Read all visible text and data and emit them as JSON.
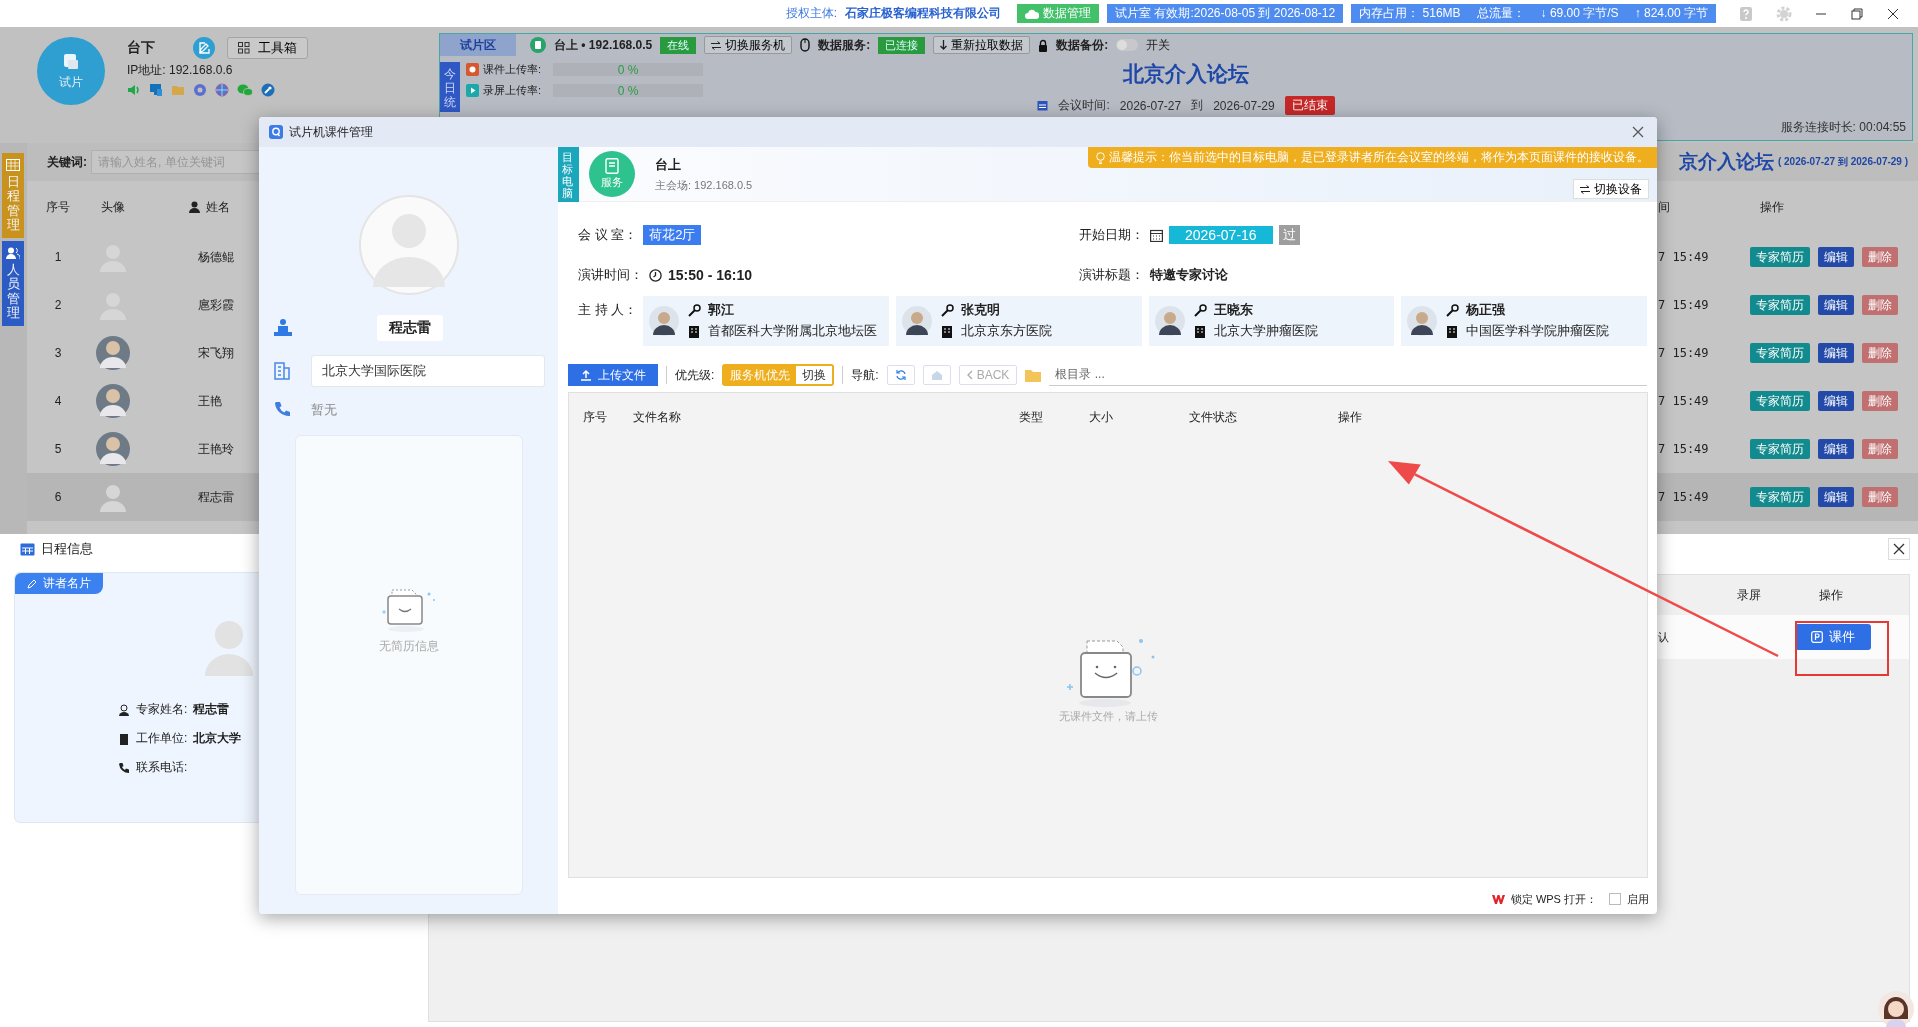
{
  "title_bar": {
    "license_label": "授权主体:",
    "license_holder": "石家庄极客编程科技有限公司",
    "data_button": "数据管理",
    "validity": "试片室 有效期:2026-08-05 到 2026-08-12",
    "memory": "内存占用： 516MB",
    "traffic_label": "总流量：",
    "download": "↓ 69.00 字节/S",
    "upload": "↑ 824.00 字节"
  },
  "station": {
    "avatar_label": "试片",
    "name": "台下",
    "toolbox_button": "工具箱",
    "ip": "IP地址: 192.168.0.6"
  },
  "status_panel": {
    "zone_tab": "试片区",
    "server": "台上 • 192.168.0.5",
    "server_status": "在线",
    "switch_button": "切换服务机",
    "data_service_label": "数据服务:",
    "data_service_status": "已连接",
    "refetch_button": "重新拉取数据",
    "backup_label": "数据备份:",
    "backup_switch": {
      "on": false,
      "label": "开关"
    },
    "stats_tab": "今日统",
    "rates": [
      {
        "label": "课件上传率:",
        "level": 0,
        "reading": "0 %"
      },
      {
        "label": "录屏上传率:",
        "level": 0,
        "reading": "0 %"
      }
    ],
    "meeting_title": "北京介入论坛",
    "meeting_time_label": "会议时间:",
    "meeting_start": "2026-07-27",
    "meeting_to": "到",
    "meeting_end": "2026-07-29",
    "meeting_status": "已结束",
    "uptime": "服务连接时长: 00:04:55"
  },
  "sidebar": [
    {
      "label": "日程管理",
      "color": "#c8921c"
    },
    {
      "label": "人员管理",
      "color": "#2c5bc4"
    }
  ],
  "people": {
    "search": {
      "label": "关键词:",
      "placeholder": "请输入姓名, 单位关键词"
    },
    "forum_title": "京介入论坛",
    "forum_dates": "( 2026-07-27 到 2026-07-29 )",
    "columns": [
      "序号",
      "头像",
      "姓名",
      "间",
      "操作"
    ],
    "rows": [
      {
        "index": "1",
        "name": "杨德鲲",
        "photo": false,
        "time": "7 15:49",
        "actions": [
          "专家简历",
          "编辑",
          "删除"
        ],
        "selected": false
      },
      {
        "index": "2",
        "name": "扈彩霞",
        "photo": false,
        "time": "7 15:49",
        "actions": [
          "专家简历",
          "编辑",
          "删除"
        ],
        "selected": false
      },
      {
        "index": "3",
        "name": "宋飞翔",
        "photo": true,
        "time": "7 15:49",
        "actions": [
          "专家简历",
          "编辑",
          "删除"
        ],
        "selected": false
      },
      {
        "index": "4",
        "name": "王艳",
        "photo": true,
        "time": "7 15:49",
        "actions": [
          "专家简历",
          "编辑",
          "删除"
        ],
        "selected": false
      },
      {
        "index": "5",
        "name": "王艳玲",
        "photo": true,
        "time": "7 15:49",
        "actions": [
          "专家简历",
          "编辑",
          "删除"
        ],
        "selected": false
      },
      {
        "index": "6",
        "name": "程志雷",
        "photo": false,
        "time": "7 15:49",
        "actions": [
          "专家简历",
          "编辑",
          "删除"
        ],
        "selected": true
      }
    ]
  },
  "schedule_panel": {
    "title": "日程信息",
    "card_tag": "讲者名片",
    "fields": [
      {
        "label": "专家姓名:",
        "value": "程志雷"
      },
      {
        "label": "工作单位:",
        "value": "北京大学"
      },
      {
        "label": "联系电话:"
      }
    ],
    "columns": [
      "录屏",
      "操作"
    ],
    "row": {
      "cell": "认",
      "action": "课件"
    }
  },
  "dialog": {
    "title": "试片机课件管理",
    "expert": {
      "name": "程志雷",
      "institution": "北京大学国际医院",
      "phone": "暂无",
      "resume_empty": "无简历信息"
    },
    "target": {
      "tag": "目标电脑",
      "icon_label": "服务",
      "name": "台上",
      "address": "主会场: 192.168.0.5",
      "tip": "温馨提示：你当前选中的目标电脑，是已登录讲者所在会议室的终端，将作为本页面课件的接收设备。",
      "switch_button": "切换设备"
    },
    "info": {
      "room_label": "会 议 室：",
      "room": "荷花2厅",
      "date_label": "开始日期：",
      "date": "2026-07-16",
      "date_status": "过",
      "time_label": "演讲时间：",
      "time": "15:50 - 16:10",
      "topic_label": "演讲标题：",
      "topic": "特邀专家讨论",
      "hosts_label": "主 持 人：",
      "hosts": [
        {
          "name": "郭江",
          "institution": "首都医科大学附属北京地坛医"
        },
        {
          "name": "张克明",
          "institution": "北京京东方医院"
        },
        {
          "name": "王晓东",
          "institution": "北京大学肿瘤医院"
        },
        {
          "name": "杨正强",
          "institution": "中国医学科学院肿瘤医院"
        }
      ]
    },
    "toolbar": {
      "upload_button": "上传文件",
      "priority_label": "优先级:",
      "priority_options": [
        {
          "label": "服务机优先",
          "selected": true
        },
        {
          "label": "切换",
          "selected": false
        }
      ],
      "nav_label": "导航:",
      "back_button": "BACK",
      "path": "根目录 ..."
    },
    "files": {
      "columns": [
        "序号",
        "文件名称",
        "类型",
        "大小",
        "文件状态",
        "操作"
      ],
      "empty_text": "无课件文件，请上传"
    },
    "footer": {
      "lock_label": "锁定 WPS 打开：",
      "enable": {
        "checked": false,
        "label": "启用"
      }
    }
  }
}
